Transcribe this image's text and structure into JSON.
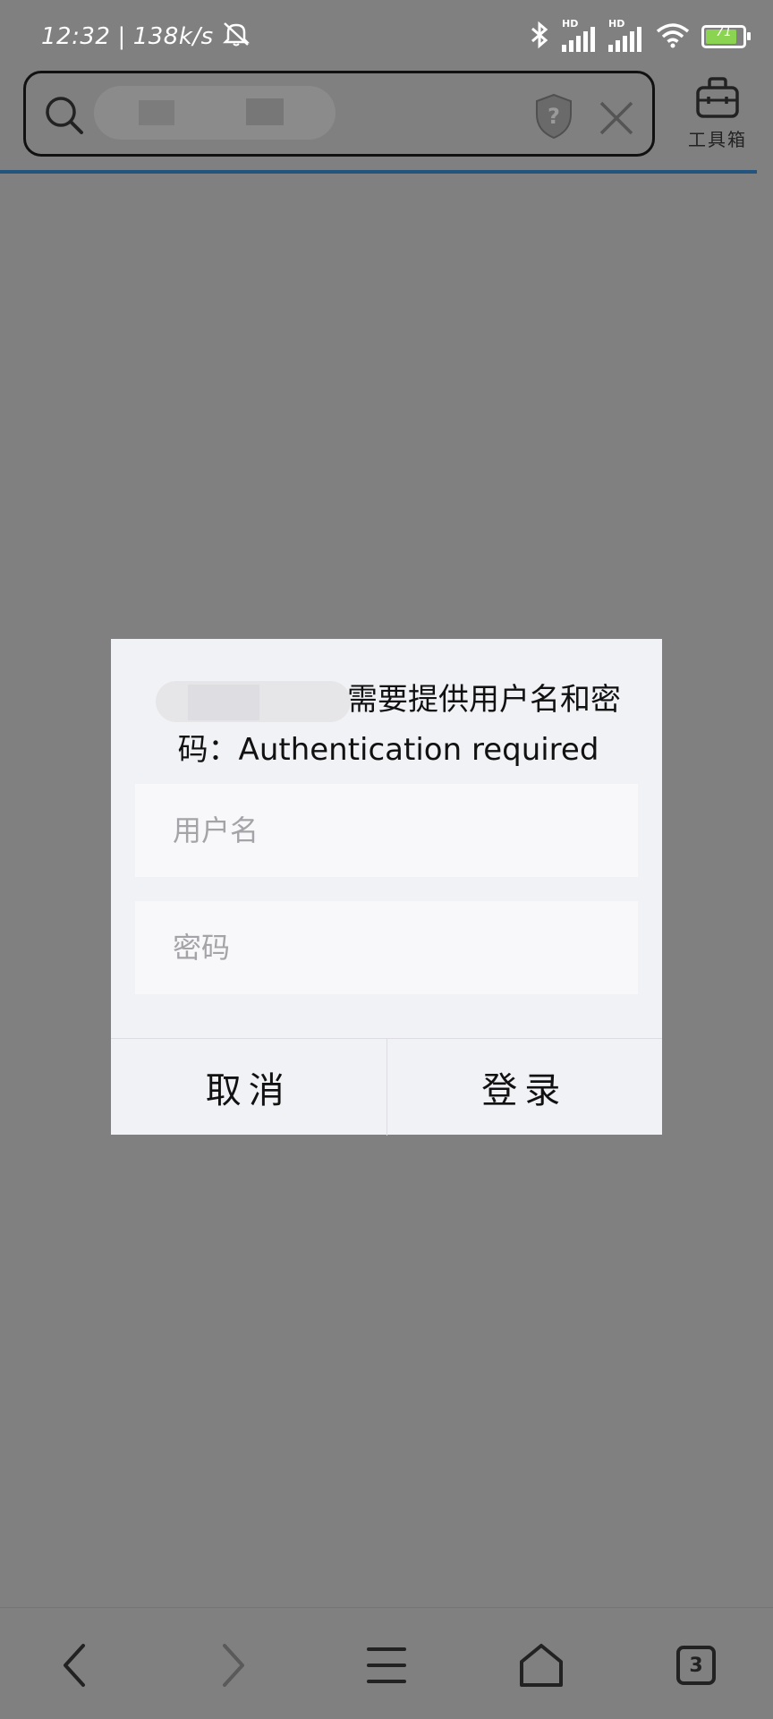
{
  "status_bar": {
    "time": "12:32",
    "separator": "|",
    "net_speed": "138k/s",
    "hd_label_1": "HD",
    "hd_label_2": "HD",
    "battery_level": "71"
  },
  "browser": {
    "toolbox_label": "工具箱",
    "tab_count": "3"
  },
  "dialog": {
    "title": "需要提供用户名和密码：Authentication required",
    "username_placeholder": "用户名",
    "password_placeholder": "密码",
    "cancel_label": "取消",
    "login_label": "登录"
  }
}
